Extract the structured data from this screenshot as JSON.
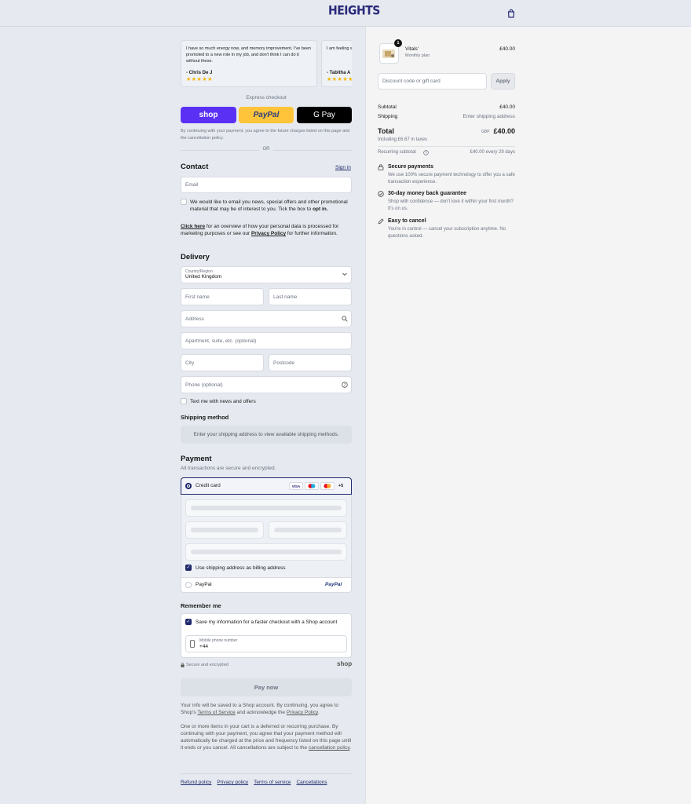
{
  "header": {
    "logo": "HEIGHTS",
    "cart_icon": "shopping-bag-icon"
  },
  "reviews": [
    {
      "text": "I have so much energy now, and memory improvement. I've been promoted to a new role in my job, and don't think I can do it without these.",
      "author": "- Chris De J",
      "stars": "★★★★★"
    },
    {
      "text": "I am feeling s recognise wh",
      "author": "- Tabitha A",
      "stars": "★★★★★"
    }
  ],
  "express": {
    "label": "Express checkout",
    "shop": "shop",
    "paypal": "PayPal",
    "gpay": "G Pay",
    "note": "By continuing with your payment, you agree to the future charges listed on this page and the cancellation policy.",
    "or": "OR"
  },
  "contact": {
    "title": "Contact",
    "signin": "Sign in",
    "email_placeholder": "Email",
    "optin_text": "We would like to email you news, special offers and other promotional material that may be of interest to you. Tick the box to ",
    "optin_bold": "opt in.",
    "overview_link": "Click here",
    "overview_text1": " for an overview of how your personal data is processed for marketing purposes or see our ",
    "privacy_link": "Privacy Policy",
    "overview_text2": " for further information."
  },
  "delivery": {
    "title": "Delivery",
    "country_label": "Country/Region",
    "country": "United Kingdom",
    "first_name": "First name",
    "last_name": "Last name",
    "address": "Address",
    "apartment": "Apartment, suite, etc. (optional)",
    "city": "City",
    "postcode": "Postcode",
    "phone": "Phone (optional)",
    "text_me": "Text me with news and offers"
  },
  "shipping": {
    "title": "Shipping method",
    "note": "Enter your shipping address to view available shipping methods."
  },
  "payment": {
    "title": "Payment",
    "subtitle": "All transactions are secure and encrypted.",
    "credit_card": "Credit card",
    "visa": "VISA",
    "more": "+5",
    "billing": "Use shipping address as billing address",
    "paypal": "PayPal",
    "paypal_logo": "PayPal"
  },
  "remember": {
    "title": "Remember me",
    "save": "Save my information for a faster checkout with a Shop account",
    "phone_label": "Mobile phone number",
    "phone_value": "+44",
    "secure": "Secure and encrypted",
    "shop": "shop"
  },
  "pay": {
    "button": "Pay now",
    "info1": "Your info will be saved to a Shop account. By continuing, you agree to Shop's ",
    "tos": "Terms of Service",
    "info2": " and acknowledge the ",
    "privacy": "Privacy Policy",
    "info3": ".",
    "recurring": "One or more items in your cart is a deferred or recurring purchase. By continuing with your payment, you agree that your payment method will automatically be charged at the price and frequency listed on this page until it ends or you cancel. All cancellations are subject to the ",
    "cancel_policy": "cancellation policy",
    "recurring_end": "."
  },
  "footer_links": [
    "Refund policy",
    "Privacy policy",
    "Terms of service",
    "Cancellations"
  ],
  "summary": {
    "item_name": "Vitals'",
    "item_plan": "Monthly plan",
    "item_price": "£40.00",
    "qty": "1",
    "discount_placeholder": "Discount code or gift card",
    "apply": "Apply",
    "subtotal_label": "Subtotal",
    "subtotal": "£40.00",
    "shipping_label": "Shipping",
    "shipping": "Enter shipping address",
    "total_label": "Total",
    "taxes": "Including £6.67 in taxes",
    "currency": "GBP",
    "total": "£40.00",
    "recurring_label": "Recurring subtotal",
    "recurring": "£40.00 every 29 days",
    "benefits": [
      {
        "title": "Secure payments",
        "text": "We use 100% secure payment technology to offer you a safe transaction experience.",
        "icon": "lock-icon"
      },
      {
        "title": "30-day money back guarantee",
        "text": "Shop with confidence — don't love it within your first month? It's on us.",
        "icon": "check-circle-icon"
      },
      {
        "title": "Easy to cancel",
        "text": "You're in control — cancel your subscription anytime. No questions asked.",
        "icon": "pencil-icon"
      }
    ]
  },
  "colors": {
    "brand": "#2a2a7a",
    "shop": "#5a31f4",
    "paypal": "#ffc439",
    "accent": "#1f2a6b"
  }
}
